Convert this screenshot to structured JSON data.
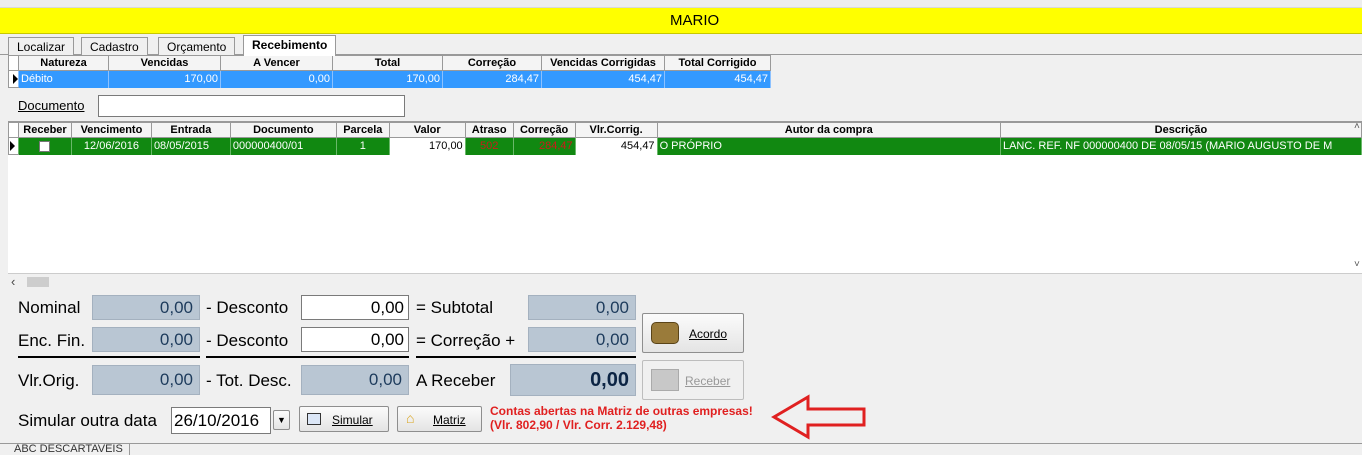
{
  "window": {
    "title": "MARIO"
  },
  "tabs": [
    "Localizar",
    "Cadastro",
    "Orçamento",
    "Recebimento"
  ],
  "summary": {
    "headers": [
      "Natureza",
      "Vencidas",
      "A Vencer",
      "Total",
      "Correção",
      "Vencidas Corrigidas",
      "Total Corrigido"
    ],
    "row": [
      "Débito",
      "170,00",
      "0,00",
      "170,00",
      "284,47",
      "454,47",
      "454,47"
    ]
  },
  "documento": {
    "label": "Documento",
    "value": ""
  },
  "installments": {
    "headers": [
      "Receber",
      "Vencimento",
      "Entrada",
      "Documento",
      "Parcela",
      "Valor",
      "Atraso",
      "Correção",
      "Vlr.Corrig.",
      "Autor da compra",
      "Descrição"
    ],
    "row": {
      "vencimento": "12/06/2016",
      "entrada": "08/05/2015",
      "documento": "000000400/01",
      "parcela": "1",
      "valor": "170,00",
      "atraso": "502",
      "correcao": "284,47",
      "vlr_corrig": "454,47",
      "autor": "O PRÓPRIO",
      "descricao": "LANC. REF. NF 000000400 DE 08/05/15 (MARIO AUGUSTO DE M"
    }
  },
  "totals": {
    "nominal_label": "Nominal",
    "nominal": "0,00",
    "desconto_label": "- Desconto",
    "desconto1": "0,00",
    "subtotal_label": "= Subtotal",
    "subtotal": "0,00",
    "encfin_label": "Enc. Fin.",
    "encfin": "0,00",
    "desconto2": "0,00",
    "correcao_label": "= Correção +",
    "correcao": "0,00",
    "vlrorig_label": "Vlr.Orig.",
    "vlrorig": "0,00",
    "totdesc_label": "- Tot. Desc.",
    "totdesc": "0,00",
    "areceber_label": "A Receber",
    "areceber": "0,00"
  },
  "buttons": {
    "acordo": "Acordo",
    "receber": "Receber",
    "simular": "Simular",
    "matriz": "Matriz"
  },
  "simular": {
    "label": "Simular outra data",
    "date": "26/10/2016"
  },
  "alert": "Contas abertas na Matriz de outras empresas! (Vlr. 802,90 / Vlr. Corr. 2.129,48)",
  "bottom_tab": "ABC DESCARTAVEIS",
  "colors": {
    "title_bg": "#ffff00",
    "selected_row": "#3399ff",
    "green_row": "#118811",
    "alert": "#e02020"
  }
}
